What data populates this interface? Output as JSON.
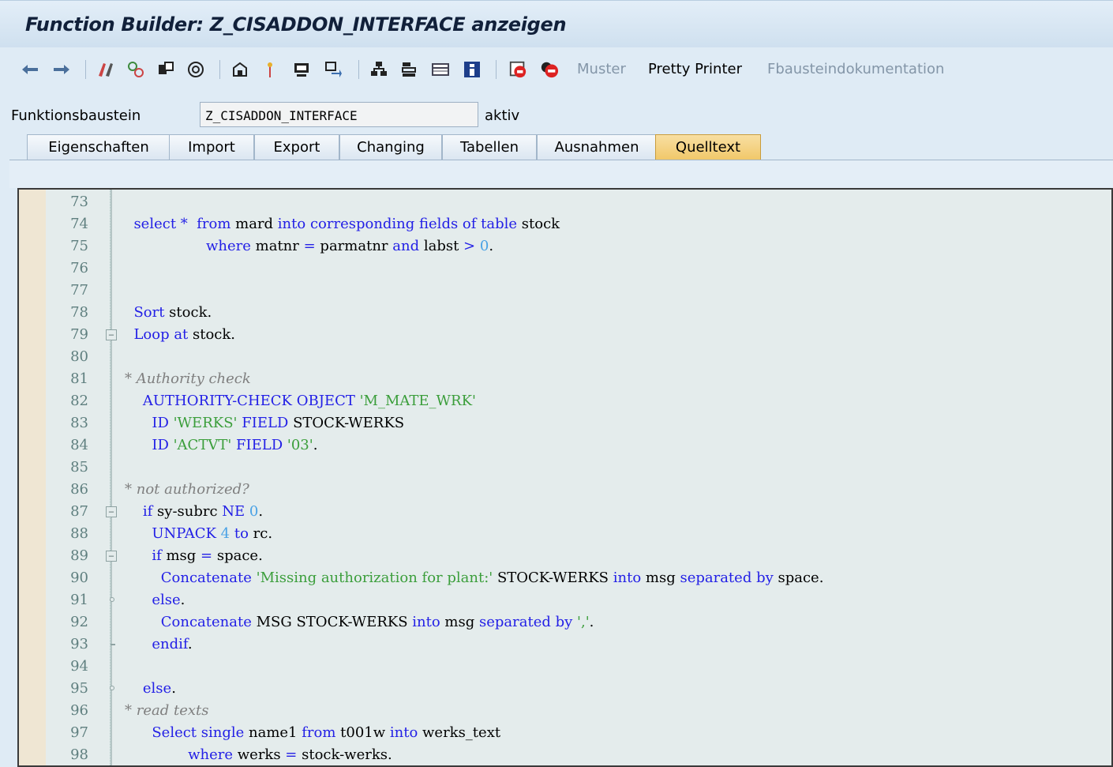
{
  "window": {
    "title": "Function Builder: Z_CISADDON_INTERFACE anzeigen"
  },
  "toolbar": {
    "icons": [
      "back-arrow-icon",
      "forward-arrow-icon",
      "toggle-edit-icon",
      "other-object-icon",
      "where-used-icon",
      "activate-icon",
      "check-icon",
      "test-icon",
      "display-object-list-icon",
      "navigation-window-icon",
      "hierarchy-icon",
      "tree-icon",
      "layout-icon",
      "info-icon",
      "set-breakpoint-icon",
      "stop-icon"
    ],
    "muster_label": "Muster",
    "pretty_printer_label": "Pretty Printer",
    "doc_label": "Fbausteindokumentation"
  },
  "fields": {
    "module_label": "Funktionsbaustein",
    "module_value": "Z_CISADDON_INTERFACE",
    "status": "aktiv"
  },
  "tabs": [
    {
      "label": "Eigenschaften"
    },
    {
      "label": "Import"
    },
    {
      "label": "Export"
    },
    {
      "label": "Changing"
    },
    {
      "label": "Tabellen"
    },
    {
      "label": "Ausnahmen"
    },
    {
      "label": "Quelltext",
      "active": true
    }
  ],
  "colors": {
    "keyword": "#2320e6",
    "string": "#3b9e3b",
    "number": "#4aa2e5",
    "comment": "#7f7f7f",
    "active_tab": "#f1c86a"
  },
  "editor": {
    "lines": [
      {
        "n": "73",
        "fold": "",
        "code": [
          {
            "t": "",
            "c": "id"
          }
        ]
      },
      {
        "n": "74",
        "fold": "",
        "code": [
          {
            "t": "  select",
            "c": "kw"
          },
          {
            "t": " ",
            "c": "id"
          },
          {
            "t": "*",
            "c": "op"
          },
          {
            "t": "  ",
            "c": "id"
          },
          {
            "t": "from",
            "c": "kw"
          },
          {
            "t": " mard ",
            "c": "id"
          },
          {
            "t": "into corresponding fields of table",
            "c": "kw"
          },
          {
            "t": " stock",
            "c": "id"
          }
        ]
      },
      {
        "n": "75",
        "fold": "",
        "code": [
          {
            "t": "                  ",
            "c": "id"
          },
          {
            "t": "where",
            "c": "kw"
          },
          {
            "t": " matnr ",
            "c": "id"
          },
          {
            "t": "=",
            "c": "op"
          },
          {
            "t": " parmatnr ",
            "c": "id"
          },
          {
            "t": "and",
            "c": "kw"
          },
          {
            "t": " labst ",
            "c": "id"
          },
          {
            "t": ">",
            "c": "op"
          },
          {
            "t": " ",
            "c": "id"
          },
          {
            "t": "0",
            "c": "num"
          },
          {
            "t": ".",
            "c": "id"
          }
        ]
      },
      {
        "n": "76",
        "fold": "",
        "code": [
          {
            "t": "",
            "c": "id"
          }
        ]
      },
      {
        "n": "77",
        "fold": "",
        "code": [
          {
            "t": "",
            "c": "id"
          }
        ]
      },
      {
        "n": "78",
        "fold": "",
        "code": [
          {
            "t": "  Sort",
            "c": "kw"
          },
          {
            "t": " stock.",
            "c": "id"
          }
        ]
      },
      {
        "n": "79",
        "fold": "box",
        "code": [
          {
            "t": "  Loop at",
            "c": "kw"
          },
          {
            "t": " stock.",
            "c": "id"
          }
        ]
      },
      {
        "n": "80",
        "fold": "",
        "code": [
          {
            "t": "",
            "c": "id"
          }
        ]
      },
      {
        "n": "81",
        "fold": "",
        "code": [
          {
            "t": "* Authority check",
            "c": "cmt"
          }
        ]
      },
      {
        "n": "82",
        "fold": "",
        "code": [
          {
            "t": "    AUTHORITY-CHECK OBJECT",
            "c": "kw"
          },
          {
            "t": " ",
            "c": "id"
          },
          {
            "t": "'M_MATE_WRK'",
            "c": "str"
          }
        ]
      },
      {
        "n": "83",
        "fold": "",
        "code": [
          {
            "t": "      ID",
            "c": "kw"
          },
          {
            "t": " ",
            "c": "id"
          },
          {
            "t": "'WERKS'",
            "c": "str"
          },
          {
            "t": " ",
            "c": "id"
          },
          {
            "t": "FIELD",
            "c": "kw"
          },
          {
            "t": " STOCK-WERKS",
            "c": "id"
          }
        ]
      },
      {
        "n": "84",
        "fold": "",
        "code": [
          {
            "t": "      ID",
            "c": "kw"
          },
          {
            "t": " ",
            "c": "id"
          },
          {
            "t": "'ACTVT'",
            "c": "str"
          },
          {
            "t": " ",
            "c": "id"
          },
          {
            "t": "FIELD",
            "c": "kw"
          },
          {
            "t": " ",
            "c": "id"
          },
          {
            "t": "'03'",
            "c": "str"
          },
          {
            "t": ".",
            "c": "id"
          }
        ]
      },
      {
        "n": "85",
        "fold": "",
        "code": [
          {
            "t": "",
            "c": "id"
          }
        ]
      },
      {
        "n": "86",
        "fold": "",
        "code": [
          {
            "t": "* not authorized?",
            "c": "cmt"
          }
        ]
      },
      {
        "n": "87",
        "fold": "box",
        "code": [
          {
            "t": "    if",
            "c": "kw"
          },
          {
            "t": " sy-subrc ",
            "c": "id"
          },
          {
            "t": "NE",
            "c": "kw"
          },
          {
            "t": " ",
            "c": "id"
          },
          {
            "t": "0",
            "c": "num"
          },
          {
            "t": ".",
            "c": "id"
          }
        ]
      },
      {
        "n": "88",
        "fold": "",
        "code": [
          {
            "t": "      UNPACK",
            "c": "kw"
          },
          {
            "t": " ",
            "c": "id"
          },
          {
            "t": "4",
            "c": "num"
          },
          {
            "t": " ",
            "c": "id"
          },
          {
            "t": "to",
            "c": "kw"
          },
          {
            "t": " rc.",
            "c": "id"
          }
        ]
      },
      {
        "n": "89",
        "fold": "box",
        "code": [
          {
            "t": "      if",
            "c": "kw"
          },
          {
            "t": " msg ",
            "c": "id"
          },
          {
            "t": "=",
            "c": "op"
          },
          {
            "t": " space.",
            "c": "id"
          }
        ]
      },
      {
        "n": "90",
        "fold": "",
        "code": [
          {
            "t": "        Concatenate",
            "c": "kw"
          },
          {
            "t": " ",
            "c": "id"
          },
          {
            "t": "'Missing authorization for plant:'",
            "c": "str"
          },
          {
            "t": " STOCK-WERKS ",
            "c": "id"
          },
          {
            "t": "into",
            "c": "kw"
          },
          {
            "t": " msg ",
            "c": "id"
          },
          {
            "t": "separated by",
            "c": "kw"
          },
          {
            "t": " space.",
            "c": "id"
          }
        ]
      },
      {
        "n": "91",
        "fold": "end",
        "code": [
          {
            "t": "      else",
            "c": "kw"
          },
          {
            "t": ".",
            "c": "id"
          }
        ]
      },
      {
        "n": "92",
        "fold": "",
        "code": [
          {
            "t": "        Concatenate",
            "c": "kw"
          },
          {
            "t": " MSG STOCK-WERKS ",
            "c": "id"
          },
          {
            "t": "into",
            "c": "kw"
          },
          {
            "t": " msg ",
            "c": "id"
          },
          {
            "t": "separated by",
            "c": "kw"
          },
          {
            "t": " ",
            "c": "id"
          },
          {
            "t": "','",
            "c": "str"
          },
          {
            "t": ".",
            "c": "id"
          }
        ]
      },
      {
        "n": "93",
        "fold": "dash",
        "code": [
          {
            "t": "      endif",
            "c": "kw"
          },
          {
            "t": ".",
            "c": "id"
          }
        ]
      },
      {
        "n": "94",
        "fold": "",
        "code": [
          {
            "t": "",
            "c": "id"
          }
        ]
      },
      {
        "n": "95",
        "fold": "end",
        "code": [
          {
            "t": "    else",
            "c": "kw"
          },
          {
            "t": ".",
            "c": "id"
          }
        ]
      },
      {
        "n": "96",
        "fold": "",
        "code": [
          {
            "t": "* read texts",
            "c": "cmt"
          }
        ]
      },
      {
        "n": "97",
        "fold": "",
        "code": [
          {
            "t": "      Select single",
            "c": "kw"
          },
          {
            "t": " name1 ",
            "c": "id"
          },
          {
            "t": "from",
            "c": "kw"
          },
          {
            "t": " t001w ",
            "c": "id"
          },
          {
            "t": "into",
            "c": "kw"
          },
          {
            "t": " werks_text",
            "c": "id"
          }
        ]
      },
      {
        "n": "98",
        "fold": "",
        "code": [
          {
            "t": "              ",
            "c": "id"
          },
          {
            "t": "where",
            "c": "kw"
          },
          {
            "t": " werks ",
            "c": "id"
          },
          {
            "t": "=",
            "c": "op"
          },
          {
            "t": " stock-werks.",
            "c": "id"
          }
        ]
      }
    ]
  }
}
